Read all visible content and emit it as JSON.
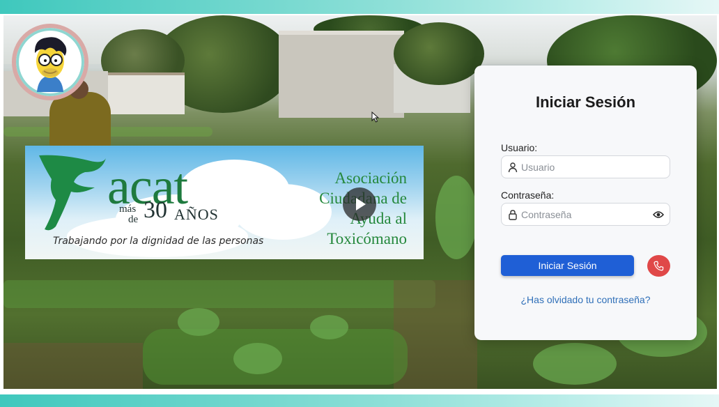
{
  "banner": {
    "logo_word": "acat",
    "logo_mas": "más",
    "logo_de": "de",
    "logo_number": "30",
    "logo_anos": "AÑOS",
    "tagline": "Trabajando por la dignidad de las personas",
    "org_name_lines": [
      "Asociación",
      "Ciudadana de",
      "Ayuda al",
      "Toxicómano"
    ]
  },
  "login": {
    "title": "Iniciar Sesión",
    "username_label": "Usuario:",
    "username_placeholder": "Usuario",
    "username_value": "",
    "password_label": "Contraseña:",
    "password_placeholder": "Contraseña",
    "password_value": "",
    "submit_label": "Iniciar Sesión",
    "forgot_link": "¿Has olvidado tu contraseña?"
  },
  "icons": {
    "avatar": "cartoon-avatar",
    "user": "user-icon",
    "lock": "lock-icon",
    "eye": "eye-icon",
    "phone": "phone-icon",
    "play": "play-icon"
  },
  "colors": {
    "accent_strip": "#3fc8bd",
    "primary_button": "#1f5fd6",
    "phone_button": "#e04848",
    "link": "#2f6fb8",
    "logo_green": "#1e7a3e"
  }
}
